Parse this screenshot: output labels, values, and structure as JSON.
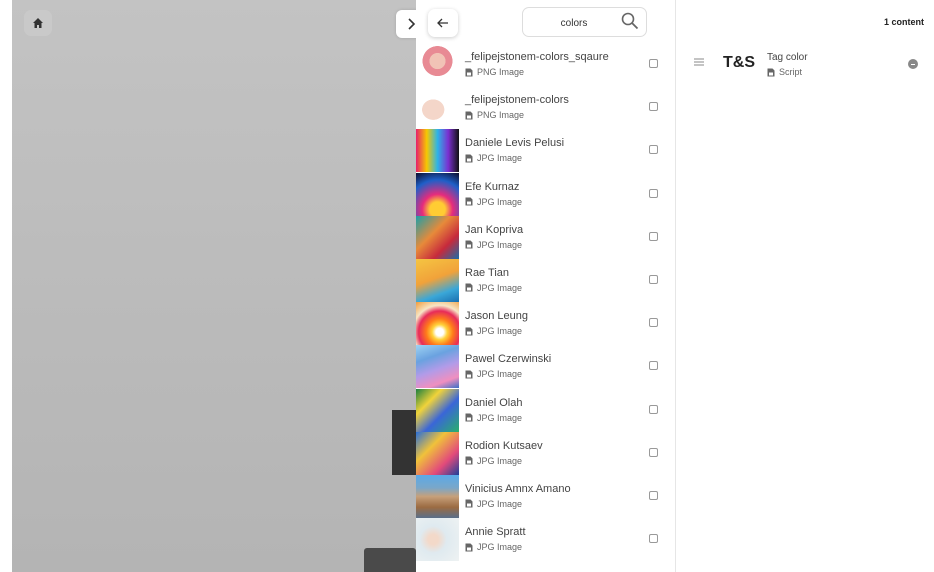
{
  "search": {
    "value": "colors"
  },
  "icons": {
    "home": "home-icon",
    "toggle": "chevron-right-icon",
    "back": "arrow-left-icon",
    "search": "search-icon",
    "file": "file-icon",
    "drag": "drag-handle-icon",
    "remove": "remove-icon"
  },
  "results": [
    {
      "name": "_felipejstonem-colors_sqaure",
      "type": "PNG Image",
      "thumb": "felipe1"
    },
    {
      "name": "_felipejstonem-colors",
      "type": "PNG Image",
      "thumb": "felipe2"
    },
    {
      "name": "Daniele Levis Pelusi",
      "type": "JPG Image",
      "thumb": "levis"
    },
    {
      "name": "Efe Kurnaz",
      "type": "JPG Image",
      "thumb": "efe"
    },
    {
      "name": "Jan Kopriva",
      "type": "JPG Image",
      "thumb": "jan"
    },
    {
      "name": "Rae Tian",
      "type": "JPG Image",
      "thumb": "rae"
    },
    {
      "name": "Jason Leung",
      "type": "JPG Image",
      "thumb": "jason"
    },
    {
      "name": "Pawel Czerwinski",
      "type": "JPG Image",
      "thumb": "pawel"
    },
    {
      "name": "Daniel Olah",
      "type": "JPG Image",
      "thumb": "olah"
    },
    {
      "name": "Rodion Kutsaev",
      "type": "JPG Image",
      "thumb": "rodion"
    },
    {
      "name": "Vinicius Amnx Amano",
      "type": "JPG Image",
      "thumb": "vinicius"
    },
    {
      "name": "Annie Spratt",
      "type": "JPG Image",
      "thumb": "annie"
    }
  ],
  "content": {
    "count_label": "1 content",
    "items": [
      {
        "logo": "T&S",
        "title": "Tag color",
        "type": "Script"
      }
    ]
  }
}
